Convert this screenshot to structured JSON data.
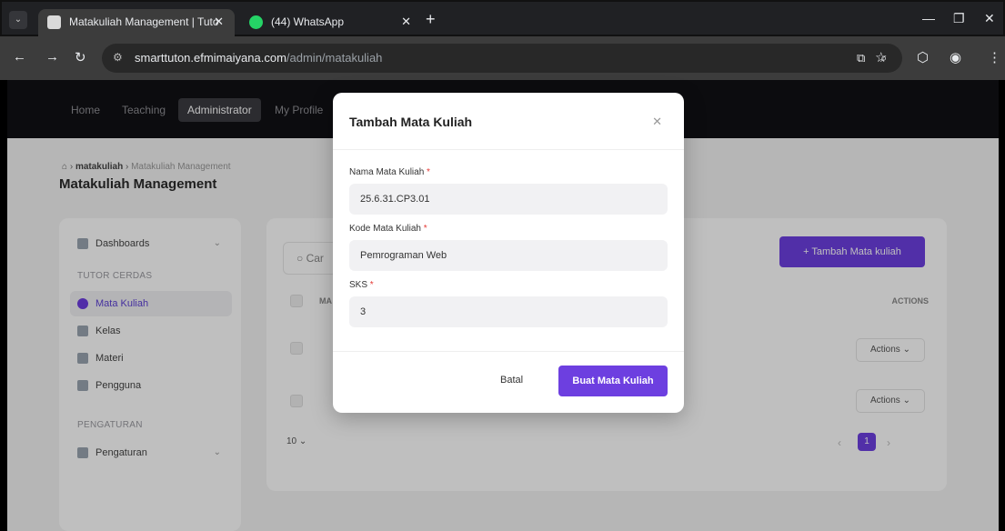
{
  "browser": {
    "tabs": [
      {
        "title": "Matakuliah Management | Tuto",
        "active": true
      },
      {
        "title": "(44) WhatsApp",
        "active": false
      }
    ],
    "url_domain": "smarttuton.efmimaiyana.com",
    "url_path": "/admin/matakuliah"
  },
  "topnav": {
    "items": [
      "Home",
      "Teaching",
      "Administrator",
      "My Profile"
    ],
    "active": "Administrator"
  },
  "breadcrumb": {
    "level1": "matakuliah",
    "level2": "Matakuliah Management"
  },
  "page_title": "Matakuliah Management",
  "sidebar": {
    "dashboards": "Dashboards",
    "section1": "TUTOR CERDAS",
    "items": [
      "Mata Kuliah",
      "Kelas",
      "Materi",
      "Pengguna"
    ],
    "section2": "PENGATURAN",
    "settings": "Pengaturan"
  },
  "content": {
    "search_placeholder": "Car",
    "add_button": "+ Tambah Mata kuliah",
    "col_first": "MA",
    "col_actions": "ACTIONS",
    "row_action_label": "Actions ⌄",
    "per_page": "10",
    "current_page": "1"
  },
  "modal": {
    "title": "Tambah Mata Kuliah",
    "fields": [
      {
        "label": "Nama Mata Kuliah",
        "value": "25.6.31.CP3.01"
      },
      {
        "label": "Kode Mata Kuliah",
        "value": "Pemrograman Web"
      },
      {
        "label": "SKS",
        "value": "3"
      }
    ],
    "cancel": "Batal",
    "submit": "Buat Mata Kuliah"
  },
  "colors": {
    "accent": "#6d3fe0",
    "required": "#e53935"
  }
}
